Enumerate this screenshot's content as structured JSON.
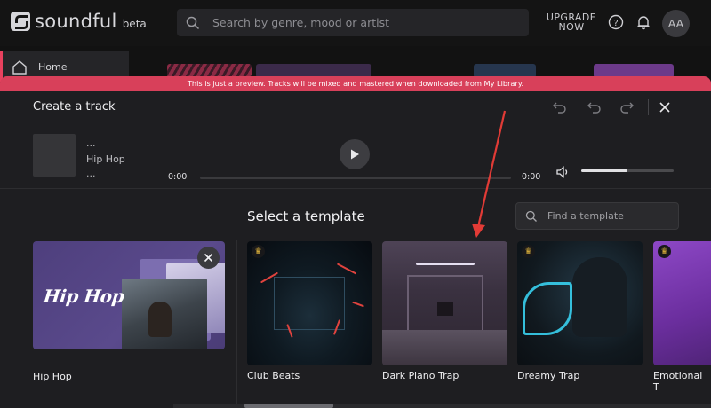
{
  "app": {
    "logo_text": "soundful",
    "logo_badge": "beta"
  },
  "topbar": {
    "search_placeholder": "Search by genre, mood or artist",
    "upgrade_line1": "UPGRADE",
    "upgrade_line2": "NOW",
    "avatar_initials": "AA"
  },
  "sidebar": {
    "items": [
      {
        "label": "Home",
        "icon": "home-icon"
      }
    ]
  },
  "banner": {
    "text": "This is just a preview. Tracks will be mixed and mastered when downloaded from My Library."
  },
  "modal": {
    "title": "Create a track",
    "header_icons": [
      "undo-all-icon",
      "undo-icon",
      "redo-icon",
      "close-icon"
    ]
  },
  "player": {
    "track_line1": "...",
    "track_genre": "Hip Hop",
    "track_line3": "...",
    "time_current": "0:00",
    "time_total": "0:00",
    "volume_level": 0.5
  },
  "templates": {
    "heading": "Select a template",
    "find_placeholder": "Find a template",
    "selected": {
      "label": "Hip Hop",
      "art_text": "Hip Hop"
    },
    "items": [
      {
        "label": "Club Beats",
        "premium": true
      },
      {
        "label": "Dark Piano Trap",
        "premium": false
      },
      {
        "label": "Dreamy Trap",
        "premium": true
      },
      {
        "label": "Emotional T",
        "premium": true
      }
    ]
  },
  "colors": {
    "accent": "#d8405a",
    "modal_bg": "#1e1e21",
    "page_bg": "#121212",
    "crown": "#e5b83c"
  }
}
